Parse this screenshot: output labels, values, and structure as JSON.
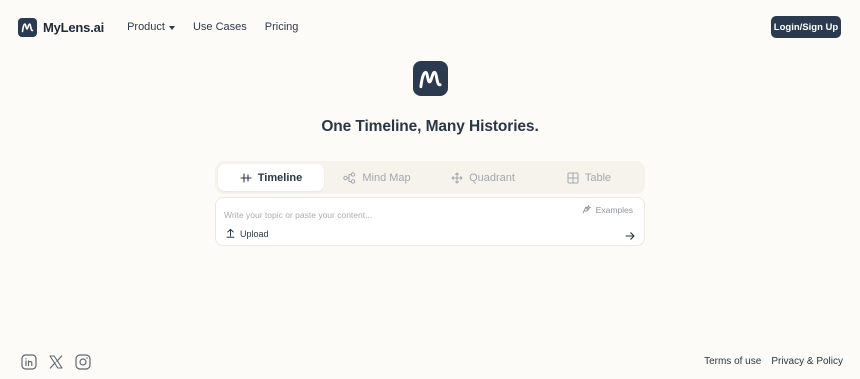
{
  "header": {
    "brand": "MyLens.ai",
    "nav": [
      {
        "label": "Product",
        "has_dropdown": true
      },
      {
        "label": "Use Cases",
        "has_dropdown": false
      },
      {
        "label": "Pricing",
        "has_dropdown": false
      }
    ],
    "login_label": "Login/Sign Up"
  },
  "hero": {
    "title": "One Timeline, Many Histories."
  },
  "tabs": [
    {
      "label": "Timeline",
      "icon": "timeline-icon",
      "active": true
    },
    {
      "label": "Mind Map",
      "icon": "mind-map-icon",
      "active": false
    },
    {
      "label": "Quadrant",
      "icon": "quadrant-icon",
      "active": false
    },
    {
      "label": "Table",
      "icon": "table-icon",
      "active": false
    }
  ],
  "input": {
    "placeholder": "Write your topic or paste your content...",
    "value": "",
    "examples_label": "Examples",
    "upload_label": "Upload"
  },
  "footer": {
    "socials": [
      "linkedin-icon",
      "x-icon",
      "instagram-icon"
    ],
    "links": [
      "Terms of use",
      "Privacy & Policy"
    ]
  },
  "colors": {
    "background": "#fcfbf7",
    "brand_dark": "#2b3a4e",
    "text": "#2b3645",
    "muted": "#a3a8ae"
  }
}
